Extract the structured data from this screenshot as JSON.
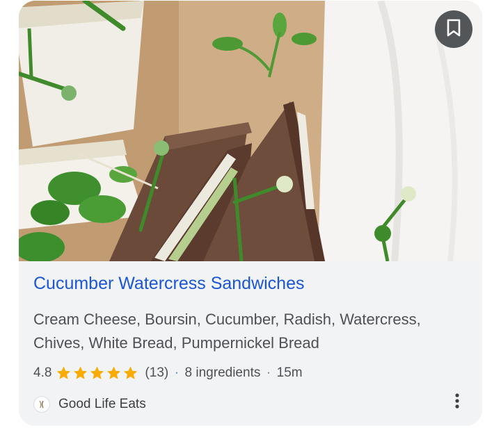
{
  "recipe": {
    "title": "Cucumber Watercress Sandwiches",
    "ingredients": "Cream Cheese, Boursin, Cucumber, Radish, Watercress, Chives, White Bread, Pumpernickel Bread",
    "rating": "4.8",
    "stars": 4.8,
    "review_count": "(13)",
    "ingredient_count": "8 ingredients",
    "time": "15m",
    "separator": "·"
  },
  "source": {
    "name": "Good Life Eats",
    "icon": "good-life-eats-logo-icon"
  },
  "actions": {
    "bookmark_icon": "bookmark-icon",
    "more_icon": "more-vert-icon"
  },
  "colors": {
    "title": "#1a56d6",
    "star": "#f9ab00",
    "card_background": "#f1f3f4",
    "bookmark_button": "#3c4043"
  }
}
